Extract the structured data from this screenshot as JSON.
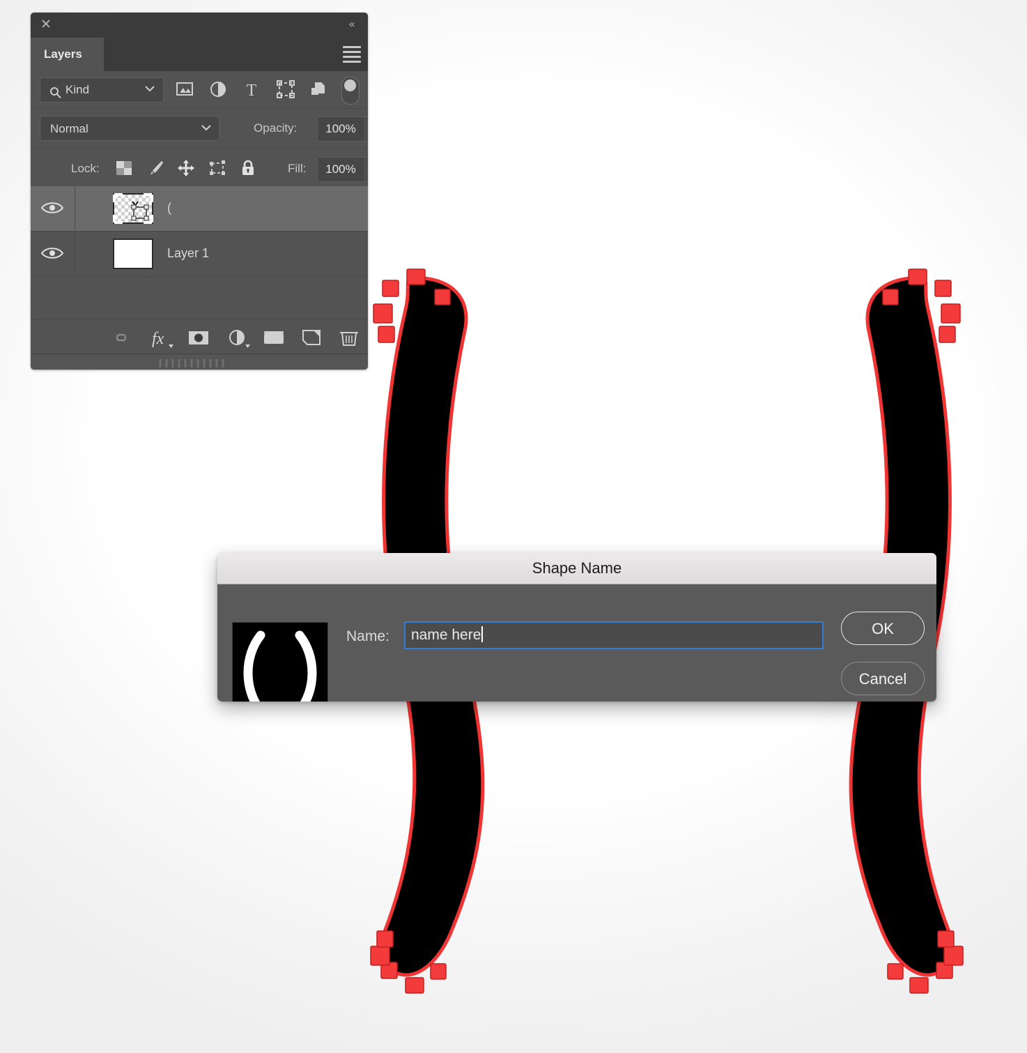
{
  "layers_panel": {
    "close_icon": "close-icon",
    "collapse_icon": "collapse-double-chevron-icon",
    "tab_label": "Layers",
    "menu_icon": "panel-menu-icon",
    "filter": {
      "search_icon": "search-icon",
      "kind_label": "Kind",
      "chevron_icon": "chevron-down-icon",
      "icons": [
        {
          "name": "filter-pixel-layers-icon",
          "title": "Pixel layers"
        },
        {
          "name": "filter-adjustment-layers-icon",
          "title": "Adjustment layers"
        },
        {
          "name": "filter-type-layers-icon",
          "title": "Type layers"
        },
        {
          "name": "filter-shape-layers-icon",
          "title": "Shape layers"
        },
        {
          "name": "filter-smart-objects-icon",
          "title": "Smart objects"
        }
      ],
      "toggle_name": "filter-enable-toggle"
    },
    "blend": {
      "mode": "Normal",
      "opacity_label": "Opacity:",
      "opacity_value": "100%"
    },
    "lock": {
      "label": "Lock:",
      "icons": [
        {
          "name": "lock-transparent-pixels-icon"
        },
        {
          "name": "lock-image-pixels-brush-icon"
        },
        {
          "name": "lock-position-move-icon"
        },
        {
          "name": "lock-artboard-nesting-icon"
        },
        {
          "name": "lock-all-padlock-icon"
        }
      ],
      "fill_label": "Fill:",
      "fill_value": "100%"
    },
    "layers": [
      {
        "name": "(",
        "visible": true,
        "selected": true,
        "thumb": "transparent-vector-shape"
      },
      {
        "name": "Layer 1",
        "visible": true,
        "selected": false,
        "thumb": "white"
      }
    ],
    "bottom_icons": [
      {
        "name": "link-layers-icon"
      },
      {
        "name": "layer-styles-fx-icon",
        "label": "fx"
      },
      {
        "name": "add-layer-mask-icon"
      },
      {
        "name": "new-adjustment-layer-icon"
      },
      {
        "name": "new-group-folder-icon"
      },
      {
        "name": "new-layer-icon"
      },
      {
        "name": "delete-layer-trash-icon"
      }
    ]
  },
  "dialog": {
    "title": "Shape Name",
    "name_label": "Name:",
    "name_value": "name here",
    "ok_label": "OK",
    "cancel_label": "Cancel",
    "preview_name": "shape-preview-thumbnail"
  },
  "canvas": {
    "shape_name": "pisces-double-arc-path",
    "path_stroke_color": "#ef3434",
    "fill_color": "#000000",
    "anchor_color": "#f33b3b"
  }
}
